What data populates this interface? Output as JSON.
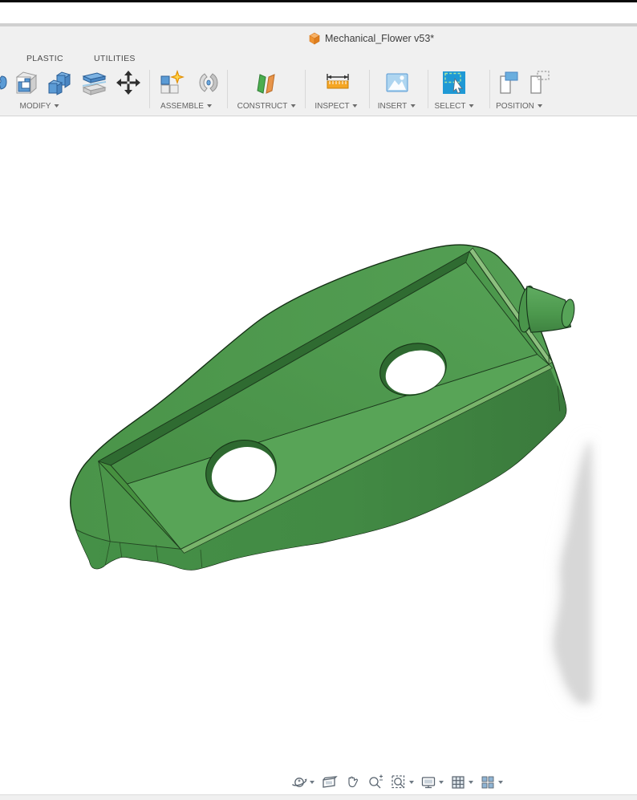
{
  "app": {
    "document_tab": {
      "title": "Mechanical_Flower v53*",
      "icon": "document-cube-icon"
    }
  },
  "ribbon": {
    "tabs": [
      {
        "label": "PLASTIC"
      },
      {
        "label": "UTILITIES"
      }
    ],
    "groups": [
      {
        "label": "MODIFY",
        "tools": [
          "shell",
          "combine",
          "split-body",
          "move"
        ]
      },
      {
        "label": "ASSEMBLE",
        "tools": [
          "new-component",
          "joint"
        ]
      },
      {
        "label": "CONSTRUCT",
        "tools": [
          "construction-plane"
        ]
      },
      {
        "label": "INSPECT",
        "tools": [
          "measure"
        ]
      },
      {
        "label": "INSERT",
        "tools": [
          "insert-image"
        ]
      },
      {
        "label": "SELECT",
        "tools": [
          "window-select"
        ]
      },
      {
        "label": "POSITION",
        "tools": [
          "capture-position",
          "revert-position"
        ]
      }
    ]
  },
  "viewport": {
    "model": "green leaf-shaped plastic body with rectangular pocket, two through-holes and a cylindrical side pin",
    "nav_toolbar": [
      "orbit",
      "look-at",
      "pan",
      "zoom",
      "fit",
      "display-settings",
      "grid-and-snaps",
      "viewports"
    ]
  },
  "colors": {
    "model_green": "#4f9b50",
    "model_green_light": "#5aa65a",
    "model_green_dark": "#35722f",
    "pocket_wall_dark": "#2f6b31",
    "edge_line": "#16341a",
    "accent_blue": "#1f99d5",
    "doc_icon_orange": "#e98a2c",
    "shadow_gray": "#d7d7d7",
    "header_bg": "#f0f0f0"
  }
}
